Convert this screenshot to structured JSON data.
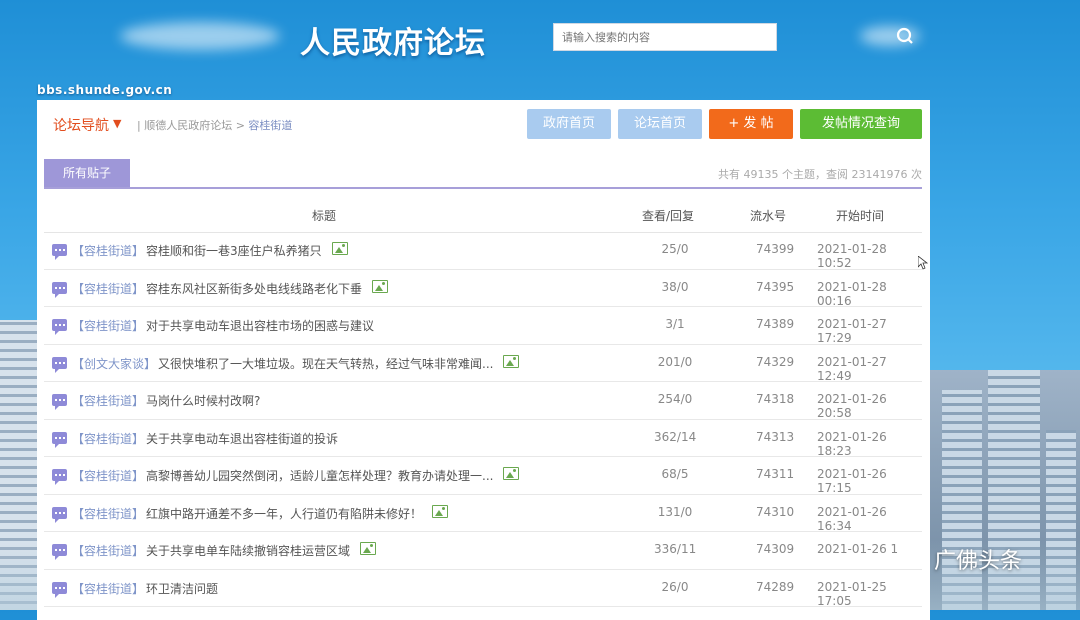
{
  "header": {
    "site_title": "人民政府论坛",
    "search_placeholder": "请输入搜索的内容",
    "site_url": "bbs.shunde.gov.cn"
  },
  "nav": {
    "label": "论坛导航",
    "breadcrumb_root": "顺德人民政府论坛",
    "breadcrumb_sep": ">",
    "breadcrumb_current": "容桂街道",
    "buttons": {
      "gov_home": "政府首页",
      "forum_home": "论坛首页",
      "post": "+ 发 帖",
      "query": "发帖情况查询"
    }
  },
  "tabs": {
    "all_posts": "所有贴子",
    "stats": "共有 49135 个主题，查阅 23141976 次"
  },
  "table": {
    "headers": {
      "title": "标题",
      "views": "查看/回复",
      "serial": "流水号",
      "time": "开始时间"
    },
    "rows": [
      {
        "category": "【容桂街道】",
        "title": "容桂顺和街一巷3座住户私养猪只",
        "has_image": true,
        "views": "25/0",
        "serial": "74399",
        "time": "2021-01-28 10:52"
      },
      {
        "category": "【容桂街道】",
        "title": "容桂东风社区新街多处电线线路老化下垂",
        "has_image": true,
        "views": "38/0",
        "serial": "74395",
        "time": "2021-01-28 00:16"
      },
      {
        "category": "【容桂街道】",
        "title": "对于共享电动车退出容桂市场的困惑与建议",
        "has_image": false,
        "views": "3/1",
        "serial": "74389",
        "time": "2021-01-27 17:29"
      },
      {
        "category": "【创文大家谈】",
        "title": "又很快堆积了一大堆垃圾。现在天气转热，经过气味非常难闻...",
        "has_image": true,
        "views": "201/0",
        "serial": "74329",
        "time": "2021-01-27 12:49"
      },
      {
        "category": "【容桂街道】",
        "title": "马岗什么时候村改啊?",
        "has_image": false,
        "views": "254/0",
        "serial": "74318",
        "time": "2021-01-26 20:58"
      },
      {
        "category": "【容桂街道】",
        "title": "关于共享电动车退出容桂街道的投诉",
        "has_image": false,
        "views": "362/14",
        "serial": "74313",
        "time": "2021-01-26 18:23"
      },
      {
        "category": "【容桂街道】",
        "title": "高黎博善幼儿园突然倒闭，适龄儿童怎样处理？教育办请处理一...",
        "has_image": true,
        "views": "68/5",
        "serial": "74311",
        "time": "2021-01-26 17:15"
      },
      {
        "category": "【容桂街道】",
        "title": "红旗中路开通差不多一年，人行道仍有陷阱未修好！",
        "has_image": true,
        "views": "131/0",
        "serial": "74310",
        "time": "2021-01-26 16:34"
      },
      {
        "category": "【容桂街道】",
        "title": "关于共享电单车陆续撤销容桂运营区域",
        "has_image": true,
        "views": "336/11",
        "serial": "74309",
        "time": "2021-01-26 1"
      },
      {
        "category": "【容桂街道】",
        "title": "环卫清洁问题",
        "has_image": false,
        "views": "26/0",
        "serial": "74289",
        "time": "2021-01-25 17:05"
      }
    ]
  },
  "watermark": "广佛头条",
  "colors": {
    "accent_orange": "#f26a1b",
    "accent_green": "#5cbc34",
    "tab_purple": "#9e97d8",
    "category_blue": "#7f95c9"
  }
}
